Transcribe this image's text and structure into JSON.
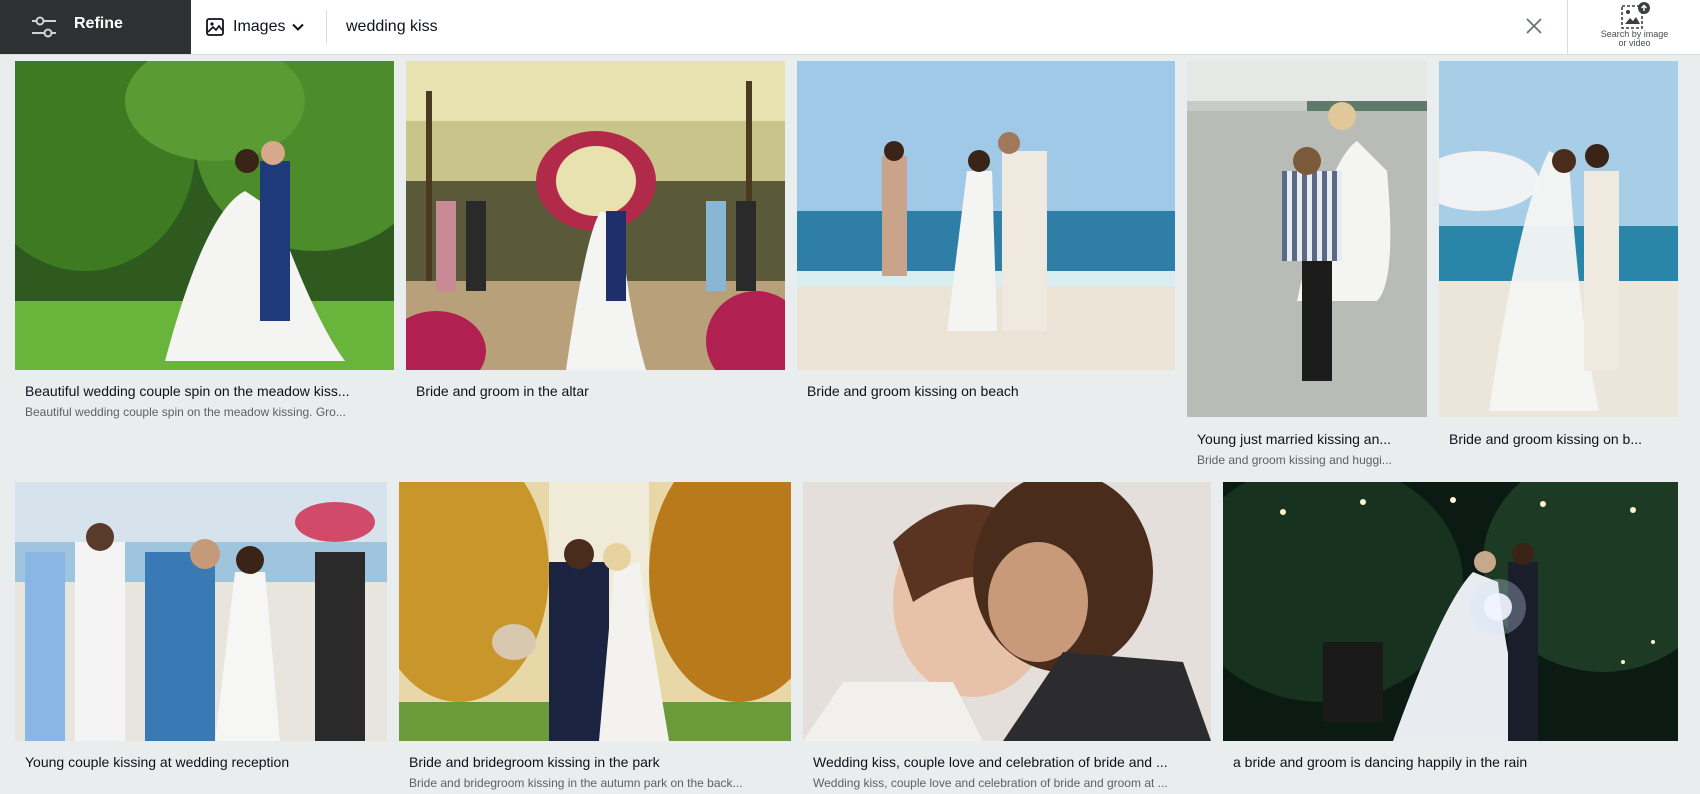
{
  "toolbar": {
    "refine_label": "Refine",
    "media_type_label": "Images",
    "search_value": "wedding kiss",
    "visual_search_line1": "Search by image",
    "visual_search_line2": "or video"
  },
  "results": [
    {
      "title": "Beautiful wedding couple spin on the meadow kiss...",
      "description": "Beautiful wedding couple spin on the meadow kissing. Gro...",
      "scene": "meadow"
    },
    {
      "title": "Bride and groom in the altar",
      "description": "",
      "scene": "altar"
    },
    {
      "title": "Bride and groom kissing on beach",
      "description": "",
      "scene": "beach"
    },
    {
      "title": "Young just married kissing an...",
      "description": "Bride and groom kissing and huggi...",
      "scene": "sea-lift"
    },
    {
      "title": "Bride and groom kissing on b...",
      "description": "",
      "scene": "beach-veil"
    },
    {
      "title": "Young couple kissing at wedding reception",
      "description": "",
      "scene": "reception"
    },
    {
      "title": "Bride and bridegroom kissing in the park",
      "description": "Bride and bridegroom kissing in the autumn park on the back...",
      "scene": "park"
    },
    {
      "title": "Wedding kiss, couple love and celebration of bride and ...",
      "description": "Wedding kiss, couple love and celebration of bride and groom at ...",
      "scene": "closeup"
    },
    {
      "title": "a bride and groom is dancing happily in the rain",
      "description": "",
      "scene": "night"
    }
  ],
  "colors": {
    "refine_bg": "#2e3131",
    "page_bg": "#eaeded",
    "accent": "#0c121c"
  }
}
